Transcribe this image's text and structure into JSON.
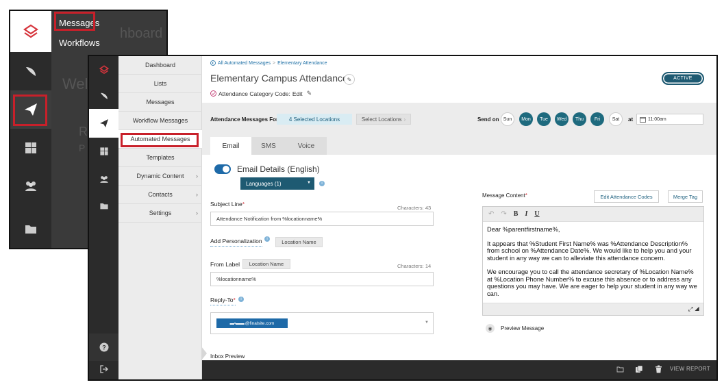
{
  "back": {
    "flyout_items": [
      "Messages",
      "Workflows"
    ],
    "ghost": [
      "hboard",
      "Wel",
      "R",
      "P"
    ]
  },
  "nav": {
    "items": [
      {
        "label": "Dashboard",
        "chevron": false
      },
      {
        "label": "Lists",
        "chevron": false
      },
      {
        "label": "Messages",
        "chevron": false
      },
      {
        "label": "Workflow Messages",
        "chevron": false
      },
      {
        "label": "Automated Messages",
        "chevron": false,
        "selected": true
      },
      {
        "label": "Templates",
        "chevron": false
      },
      {
        "label": "Dynamic Content",
        "chevron": true
      },
      {
        "label": "Contacts",
        "chevron": true
      },
      {
        "label": "Settings",
        "chevron": true
      }
    ]
  },
  "rail_icons": [
    "logo-icon",
    "feather-icon",
    "paper-plane-icon",
    "dashboard-grid-icon",
    "people-icon",
    "folder-icon"
  ],
  "breadcrumb": {
    "back_label": "All Automated Messages",
    "current": "Elementary Attendance"
  },
  "title": "Elementary Campus Attendance",
  "category": {
    "label": "Attendance Category Code:",
    "edit": "Edit"
  },
  "status": "ACTIVE",
  "attendance": {
    "label": "Attendance Messages For",
    "selected": "4 Selected Locations",
    "select_btn": "Select Locations",
    "send_on": "Send on",
    "days": [
      {
        "label": "Sun",
        "on": false
      },
      {
        "label": "Mon",
        "on": true
      },
      {
        "label": "Tue",
        "on": true
      },
      {
        "label": "Wed",
        "on": true
      },
      {
        "label": "Thu",
        "on": true
      },
      {
        "label": "Fri",
        "on": true
      },
      {
        "label": "Sat",
        "on": false
      }
    ],
    "at": "at",
    "time": "11:00am"
  },
  "tabs": [
    "Email",
    "SMS",
    "Voice"
  ],
  "email": {
    "details_label": "Email Details (English)",
    "languages": "Languages (1)",
    "subject_label": "Subject Line",
    "subject_chars": "Characters: 43",
    "subject_value": "Attendance Notification from %locationname%",
    "personalization_label": "Add Personalization",
    "personalization_chip": "Location Name",
    "from_label": "From Label",
    "from_chip": "Location Name",
    "from_chars": "Characters: 14",
    "from_value": "%locationname%",
    "reply_label": "Reply-To",
    "reply_value": "@finalsite.com",
    "inbox_preview": "Inbox Preview"
  },
  "message": {
    "label": "Message Content",
    "edit_codes": "Edit Attendance Codes",
    "merge_tag": "Merge Tag",
    "toolbar": [
      "↶",
      "↷",
      "B",
      "I",
      "U"
    ],
    "paragraphs": [
      "Dear %parentfirstname%,",
      "It appears that %Student First Name% was %Attendance Description% from school on %Attendance Date%.  We would like to help you and your student in any way we can to alleviate this attendance concern.",
      "We encourage you to call the attendance secretary of %Location Name% at %Location Phone Number% to excuse this absence or to address any questions you may have.  We are eager to help your student in any way we can."
    ],
    "preview": "Preview Message"
  },
  "bottom": {
    "view_report": "VIEW REPORT"
  }
}
